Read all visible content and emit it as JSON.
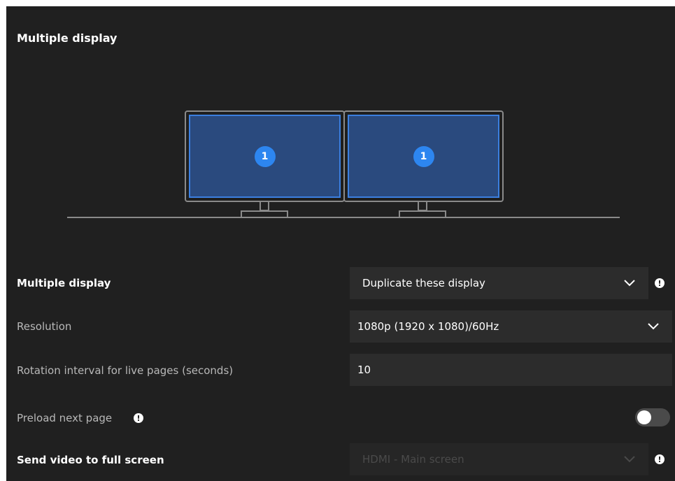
{
  "heading": "Multiple display",
  "diagram": {
    "monitors": [
      {
        "badge": "1"
      },
      {
        "badge": "1"
      }
    ]
  },
  "rows": {
    "multiple_display": {
      "label": "Multiple display",
      "value": "Duplicate these display",
      "chevron_icon": "chevron-down-icon",
      "info_icon": "info-icon"
    },
    "resolution": {
      "label": "Resolution",
      "value": "1080p (1920 x 1080)/60Hz",
      "chevron_icon": "chevron-down-icon"
    },
    "rotation": {
      "label": "Rotation interval for live pages (seconds)",
      "value": "10"
    },
    "preload": {
      "label": "Preload next page",
      "info_icon": "info-icon",
      "toggle_on": false
    },
    "send_video": {
      "label": "Send video to full screen",
      "value": "HDMI - Main screen",
      "disabled": true,
      "chevron_icon": "chevron-down-icon",
      "info_icon": "info-icon"
    }
  },
  "colors": {
    "panel": "#202020",
    "accent": "#2d86f0",
    "screen": "#2a4a7e"
  }
}
